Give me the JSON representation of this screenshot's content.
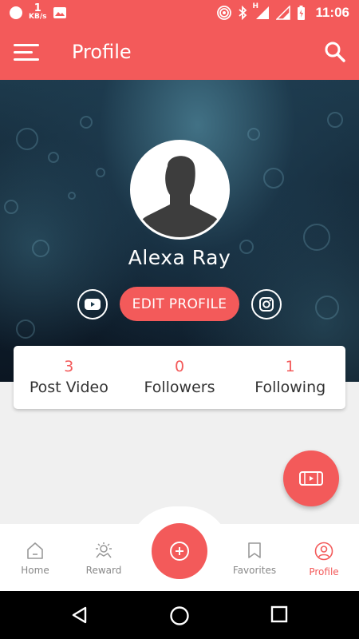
{
  "status_bar": {
    "net_speed_value": "1",
    "net_speed_unit": "KB/s",
    "network_type": "H",
    "time": "11:06",
    "icons": [
      "record-dot-icon",
      "image-notification-icon",
      "hotspot-icon",
      "bluetooth-icon",
      "signal-icon",
      "signal-icon",
      "battery-icon"
    ]
  },
  "appbar": {
    "title": "Profile",
    "menu_icon": "hamburger-menu-icon",
    "search_icon": "search-icon"
  },
  "profile": {
    "name": "Alexa Ray",
    "edit_button": "EDIT PROFILE",
    "left_social_icon": "youtube-icon",
    "right_social_icon": "instagram-icon"
  },
  "stats": [
    {
      "value": "3",
      "label": "Post Video"
    },
    {
      "value": "0",
      "label": "Followers"
    },
    {
      "value": "1",
      "label": "Following"
    }
  ],
  "bottom_nav": {
    "items": [
      {
        "label": "Home",
        "icon": "home-icon",
        "active": false
      },
      {
        "label": "Reward",
        "icon": "reward-icon",
        "active": false
      },
      {
        "label": "Favorites",
        "icon": "bookmark-icon",
        "active": false
      },
      {
        "label": "Profile",
        "icon": "user-icon",
        "active": true
      }
    ],
    "center_icon": "add-circle-icon"
  },
  "colors": {
    "accent": "#f35a5a",
    "text": "#333333",
    "inactive": "#888888"
  }
}
